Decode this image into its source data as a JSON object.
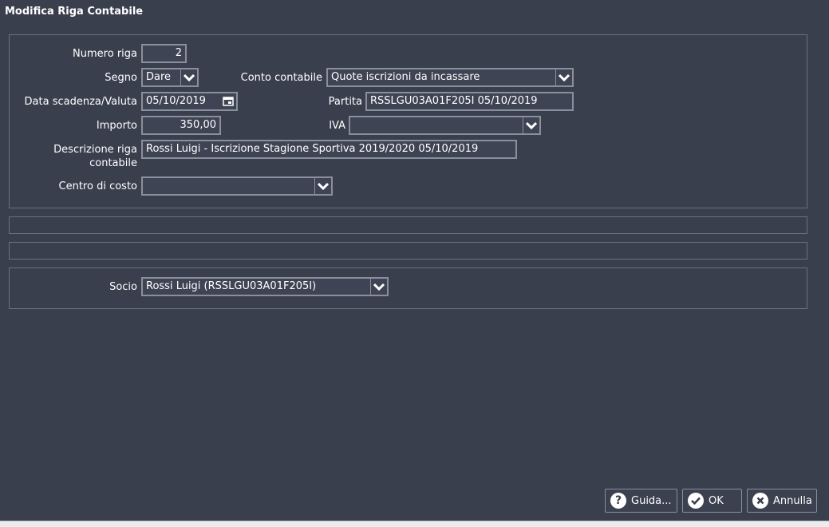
{
  "window": {
    "title": "Modifica Riga Contabile"
  },
  "form": {
    "numero_riga": {
      "label": "Numero riga",
      "value": "2"
    },
    "segno": {
      "label": "Segno",
      "value": "Dare"
    },
    "conto_contabile": {
      "label": "Conto contabile",
      "value": "Quote iscrizioni da incassare"
    },
    "data_scadenza": {
      "label": "Data scadenza/Valuta",
      "value": "05/10/2019"
    },
    "partita": {
      "label": "Partita",
      "value": "RSSLGU03A01F205I 05/10/2019"
    },
    "importo": {
      "label": "Importo",
      "value": "350,00"
    },
    "iva": {
      "label": "IVA",
      "value": ""
    },
    "descrizione": {
      "label_line1": "Descrizione riga",
      "label_line2": "contabile",
      "value": "Rossi Luigi - Iscrizione Stagione Sportiva 2019/2020  05/10/2019"
    },
    "centro_costo": {
      "label": "Centro di costo",
      "value": ""
    }
  },
  "socio": {
    "label": "Socio",
    "value": "Rossi Luigi (RSSLGU03A01F205I)"
  },
  "buttons": {
    "guida": "Guida...",
    "ok": "OK",
    "annulla": "Annulla"
  },
  "colors": {
    "background": "#3a3f4e",
    "field_border": "#8a8f9c",
    "panel_border": "#6b7080",
    "text": "#ffffff"
  }
}
